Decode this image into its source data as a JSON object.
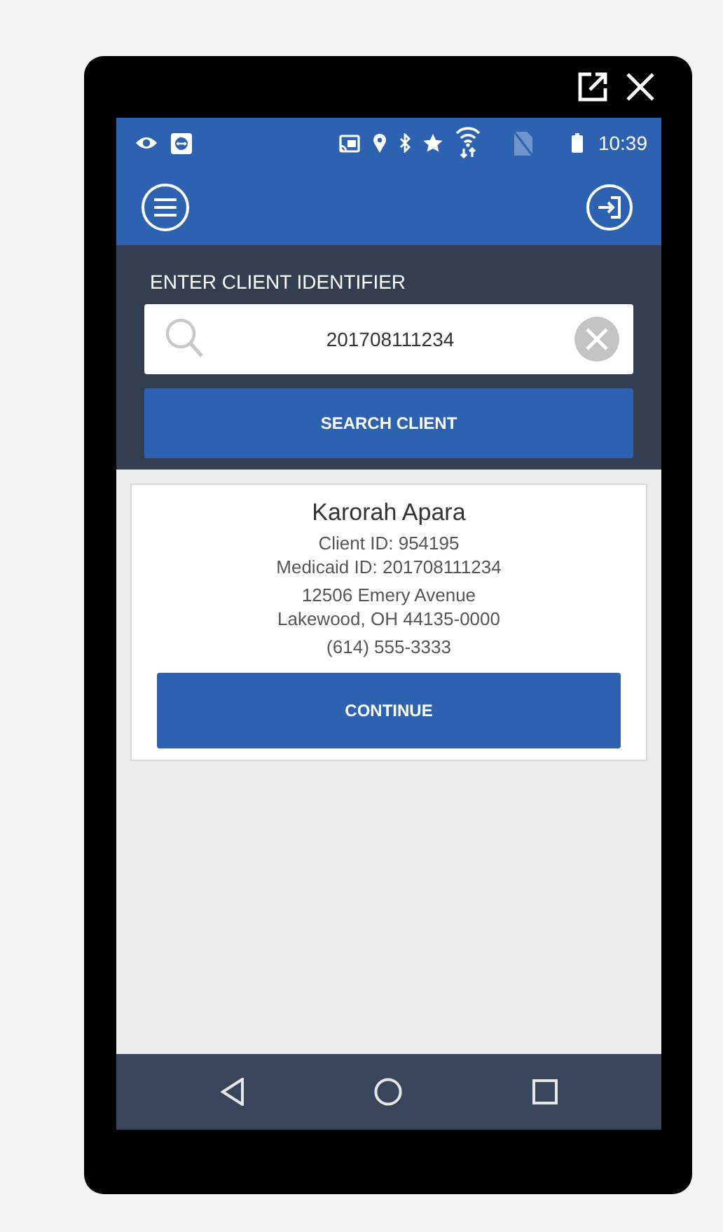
{
  "status_bar": {
    "time": "10:39"
  },
  "search": {
    "label": "ENTER CLIENT IDENTIFIER",
    "value": "201708111234",
    "button": "SEARCH CLIENT"
  },
  "client": {
    "name": "Karorah Apara",
    "details": [
      "Client ID: 954195",
      "Medicaid ID: 201708111234",
      "12506 Emery Avenue",
      "Lakewood, OH 44135-0000",
      "(614) 555-3333"
    ],
    "button": "CONTINUE"
  }
}
